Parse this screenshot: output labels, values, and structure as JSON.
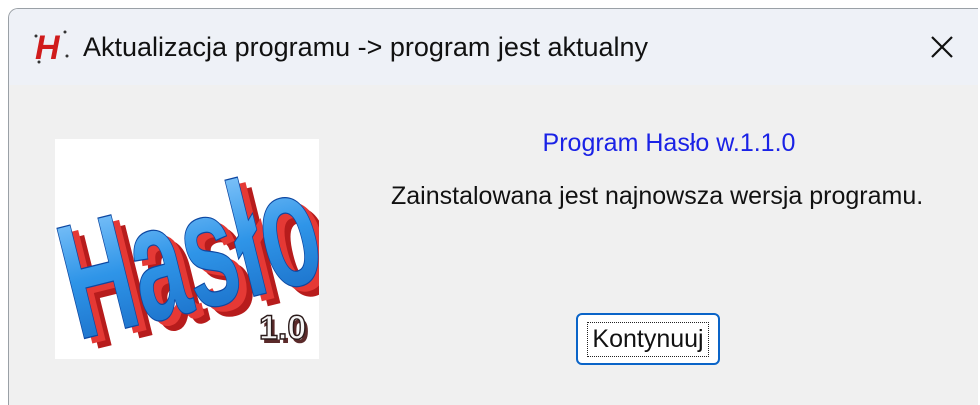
{
  "window": {
    "title": "Aktualizacja programu -> program jest aktualny",
    "app_icon": "H-logo-icon",
    "close_icon": "close-icon"
  },
  "content": {
    "version_label": "Program Hasło w.1.1.0",
    "message": "Zainstalowana jest najnowsza wersja programu.",
    "continue_label": "Kontynuuj"
  },
  "logo": {
    "text": "Hasło",
    "version_text": "1.0"
  },
  "colors": {
    "version_text": "#1a22e6",
    "button_border": "#0a64c8",
    "logo_red": "#d01c1c",
    "logo_blue": "#1e88e5"
  }
}
